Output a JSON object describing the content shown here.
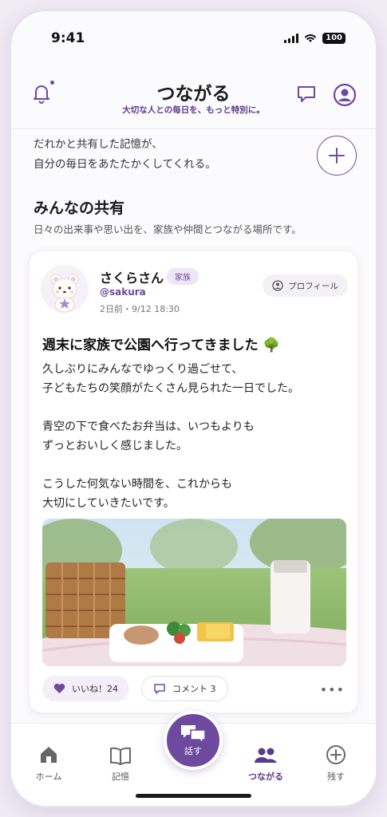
{
  "status": {
    "time": "9:41",
    "battery": "100"
  },
  "header": {
    "title": "つながる",
    "subtitle": "大切な人との毎日を、もっと特別に。"
  },
  "intro": {
    "line1": "だれかと共有した記憶が、",
    "line2": "自分の毎日をあたたかくしてくれる。"
  },
  "section": {
    "title": "みんなの共有",
    "subtitle": "日々の出来事や思い出を、家族や仲間とつながる場所です。"
  },
  "post": {
    "author": "さくらさん",
    "tag": "家族",
    "handle": "@sakura",
    "date": "2日前・9/12 18:30",
    "profile_label": "プロフィール",
    "title": "週末に家族で公園へ行ってきました 🌳",
    "paragraphs": [
      "久しぶりにみんなでゆっくり過ごせて、\n子どもたちの笑顔がたくさん見られた一日でした。",
      "青空の下で食べたお弁当は、いつもよりも\nずっとおいしく感じました。",
      "こうした何気ない時間を、これからも\n大切にしていきたいです。"
    ],
    "like_label": "いいね！24",
    "comment_label": "コメント 3"
  },
  "tabs": {
    "home": "ホーム",
    "memory": "記憶",
    "talk": "話す",
    "connect": "つながる",
    "leave": "残す"
  },
  "colors": {
    "accent": "#6d4a9e",
    "background": "#fbfafc"
  }
}
